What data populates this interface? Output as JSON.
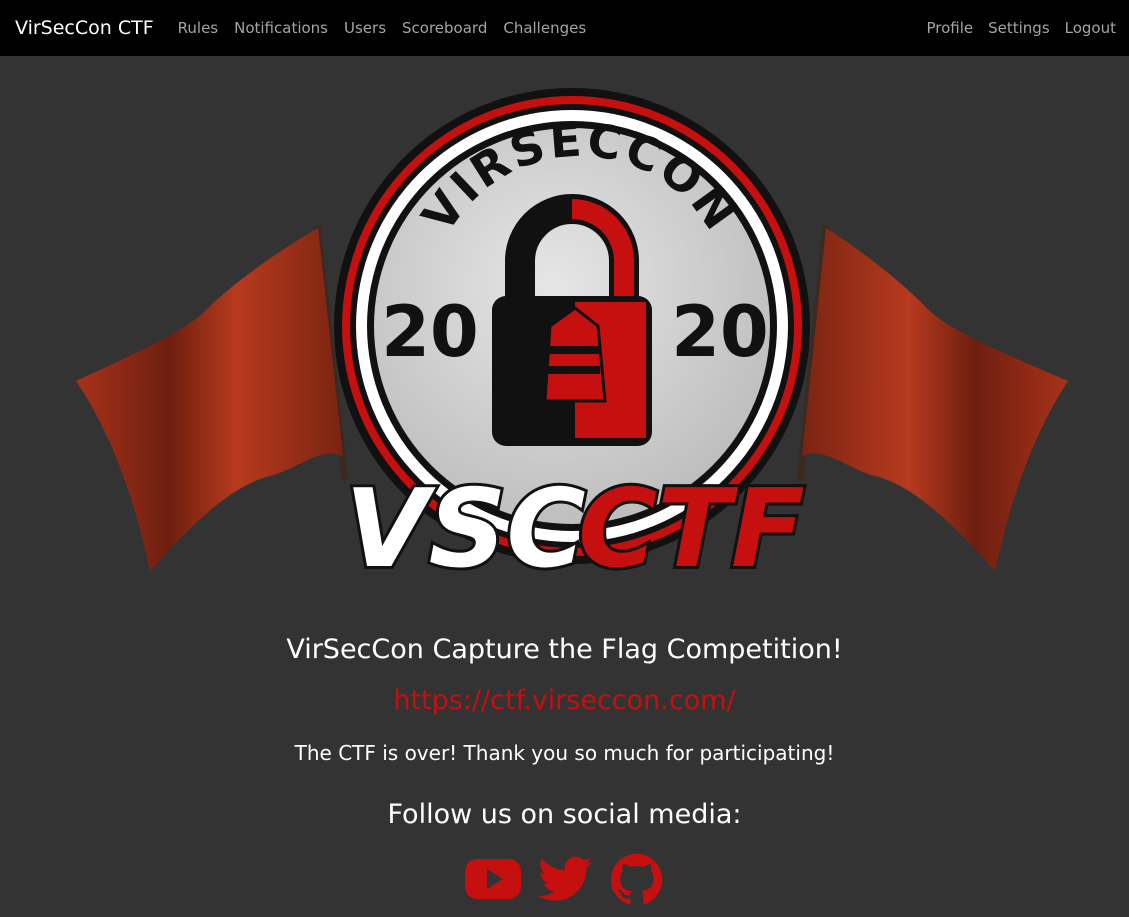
{
  "nav": {
    "brand": "VirSecCon CTF",
    "left_links": [
      "Rules",
      "Notifications",
      "Users",
      "Scoreboard",
      "Challenges"
    ],
    "right_links": [
      "Profile",
      "Settings",
      "Logout"
    ]
  },
  "logo": {
    "arc_text": "VIRSECCON",
    "year_left": "20",
    "year_right": "20",
    "wordmark_white": "VSC",
    "wordmark_red": "CTF"
  },
  "content": {
    "title": "VirSecCon Capture the Flag Competition!",
    "url": "https://ctf.virseccon.com/",
    "message": "The CTF is over! Thank you so much for participating!",
    "follow": "Follow us on social media:"
  },
  "socials": [
    {
      "name": "youtube-icon"
    },
    {
      "name": "twitter-icon"
    },
    {
      "name": "github-icon"
    }
  ],
  "colors": {
    "accent": "#c60f0f",
    "background": "#333333",
    "navbar": "#000000",
    "nav_link": "#a4a4a4"
  }
}
